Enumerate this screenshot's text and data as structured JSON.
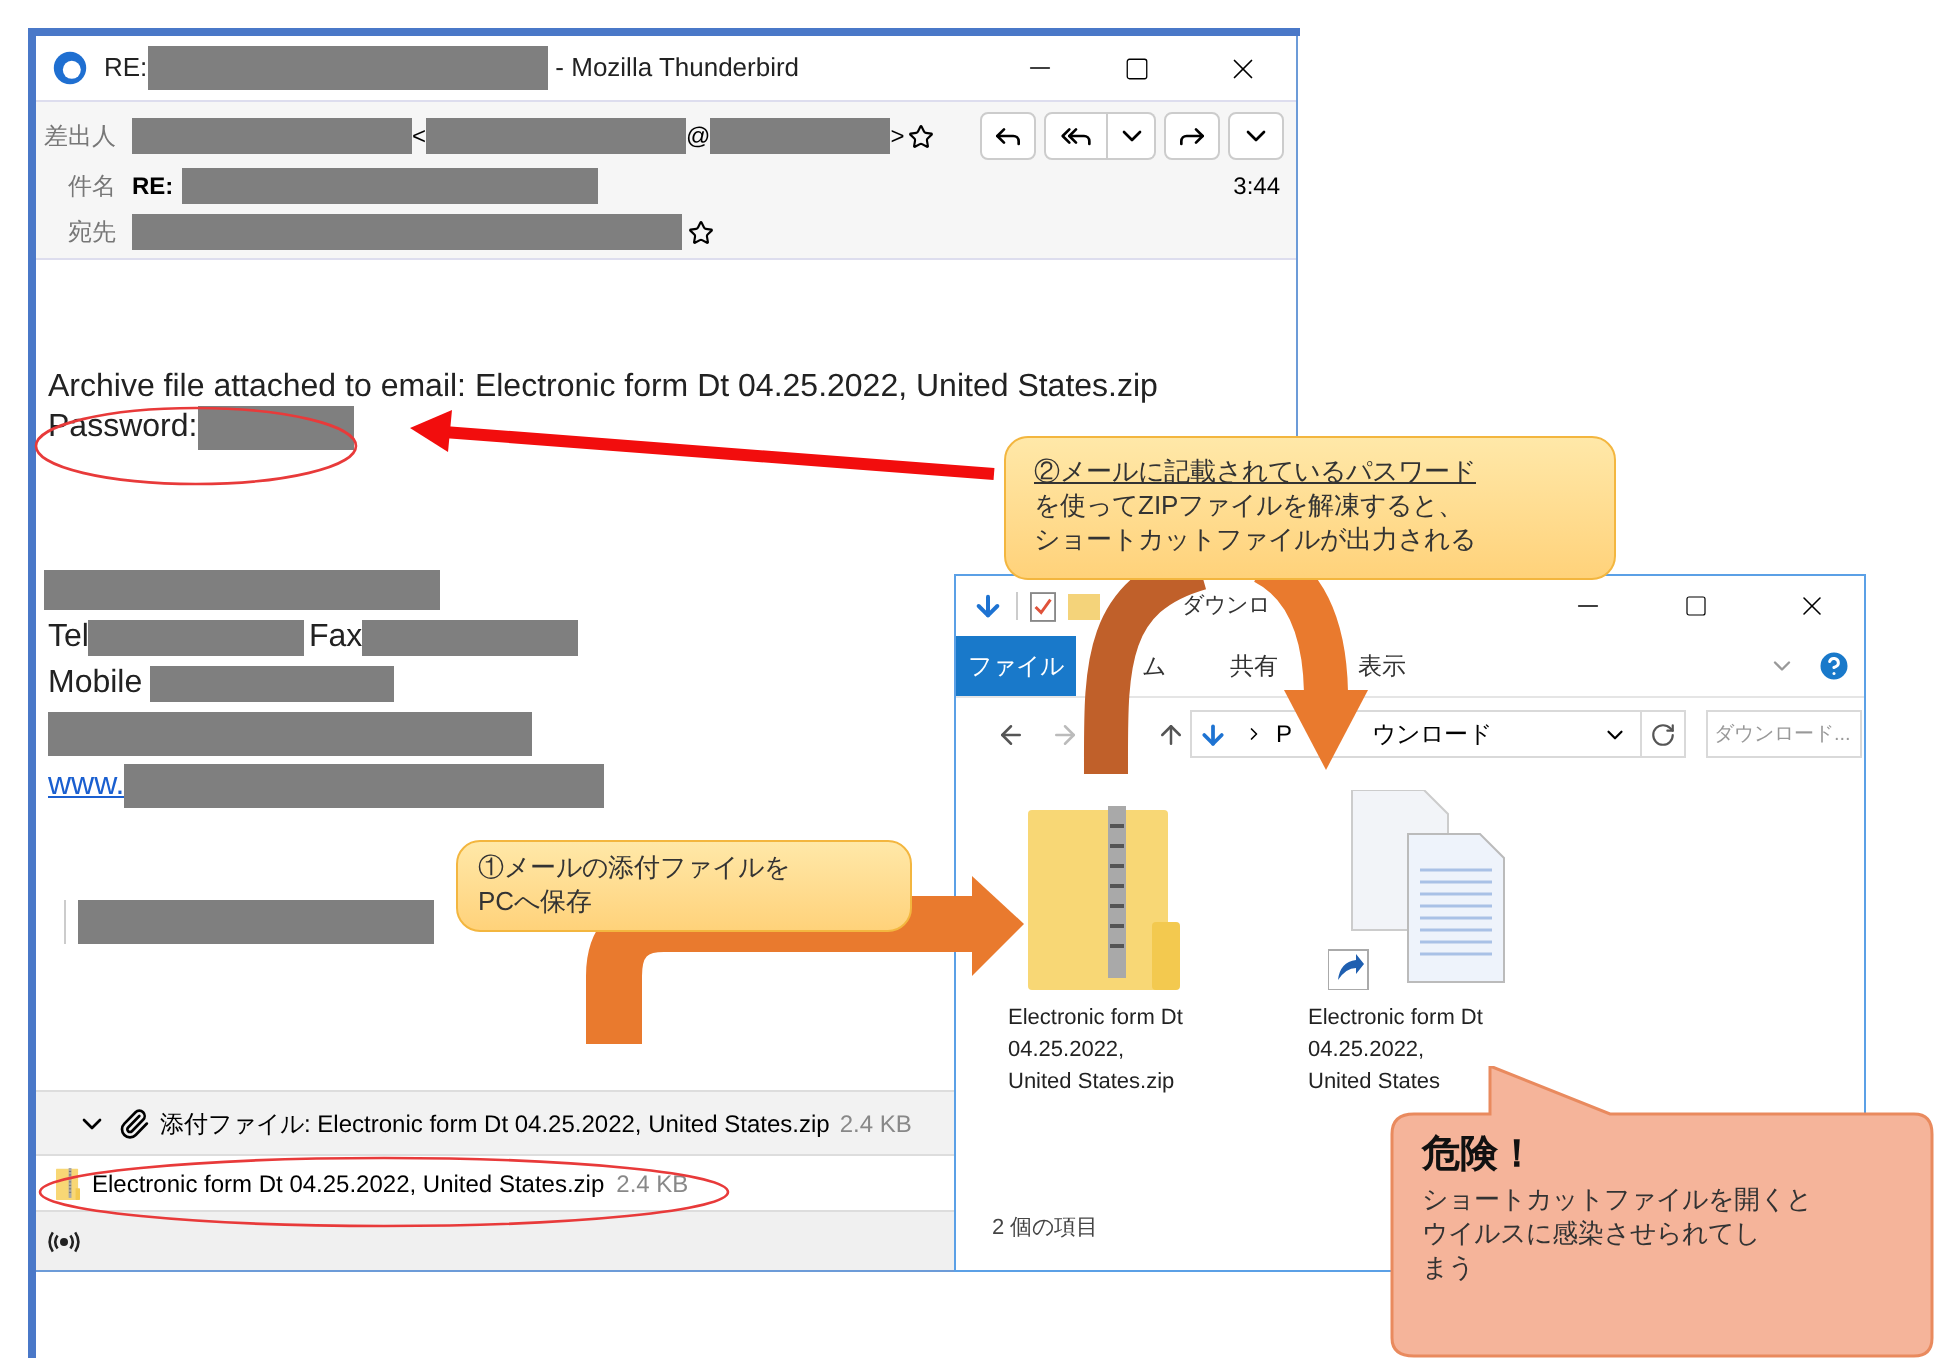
{
  "mail_window": {
    "title_prefix": "RE:",
    "title_suffix": "- Mozilla Thunderbird",
    "header": {
      "from_label": "差出人",
      "from_open": "<",
      "from_at": "@",
      "from_close": ">",
      "subject_label": "件名",
      "subject_prefix": "RE:",
      "time": "3:44",
      "to_label": "宛先"
    },
    "body": {
      "archive_line": "Archive file attached to email: Electronic form Dt 04.25.2022, United States.zip",
      "password_label": "Password:",
      "tel_label": "Tel",
      "fax_label": "Fax",
      "mobile_label": "Mobile",
      "link_prefix": "www."
    },
    "attachment_bar": {
      "expanded": true,
      "summary": "添付ファイル: Electronic form Dt 04.25.2022, United States.zip",
      "size": "2.4 KB"
    },
    "attachments": [
      {
        "name": "Electronic form Dt 04.25.2022, United States.zip",
        "size": "2.4 KB"
      }
    ]
  },
  "explorer_window": {
    "title": "ダウンロ",
    "ribbon_tabs": [
      {
        "label": "ファイル",
        "selected": true
      },
      {
        "label": "ム",
        "selected": false
      },
      {
        "label": "共有",
        "selected": false
      },
      {
        "label": "表示",
        "selected": false
      }
    ],
    "path": [
      "P",
      "ウンロード"
    ],
    "search": {
      "placeholder": "ダウンロード..."
    },
    "files": [
      {
        "kind": "zip",
        "name": "Electronic form Dt 04.25.2022, United States.zip"
      },
      {
        "kind": "shortcut",
        "name": "Electronic form Dt 04.25.2022, United States"
      }
    ],
    "status": "2 個の項目"
  },
  "callouts": [
    {
      "kind": "step",
      "lead": "②メールに記載されているパスワード",
      "lines": [
        "を使ってZIPファイルを解凍すると、",
        "ショートカットファイルが出力される"
      ]
    },
    {
      "kind": "step",
      "lines": [
        "①メールの添付ファイルを",
        "PCへ保存"
      ]
    },
    {
      "kind": "warning",
      "title": "危険！",
      "lines": [
        "ショートカットファイルを開くと",
        "ウイルスに感染させられてし",
        "まう"
      ]
    }
  ]
}
